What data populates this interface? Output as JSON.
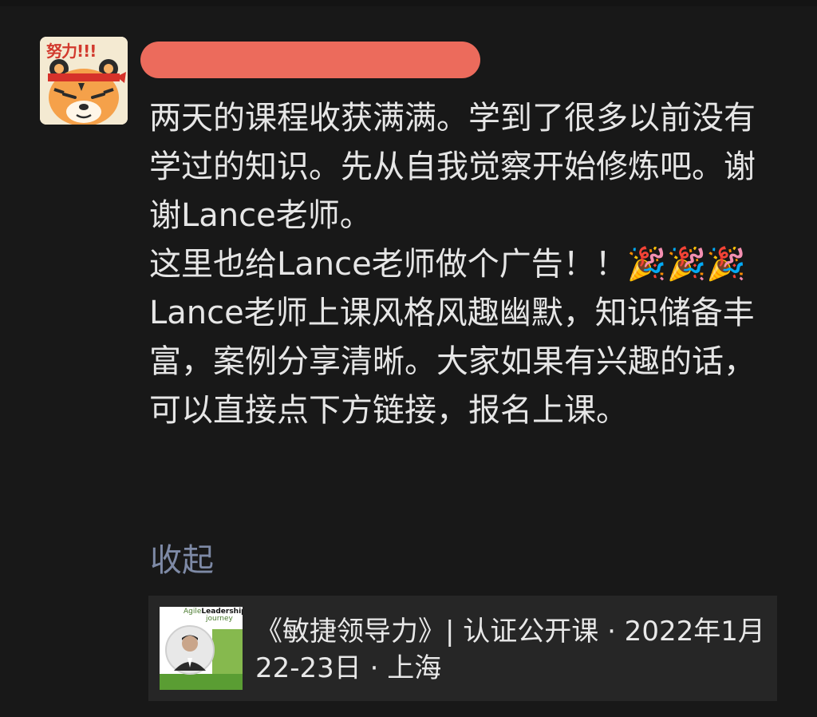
{
  "post": {
    "text": "两天的课程收获满满。学到了很多以前没有学过的知识。先从自我觉察开始修炼吧。谢谢Lance老师。\n这里也给Lance老师做个广告！！🎉🎉🎉\nLance老师上课风格风趣幽默，知识储备丰富，案例分享清晰。大家如果有兴趣的话，可以直接点下方链接，报名上课。",
    "collapse_label": "收起"
  },
  "avatar": {
    "caption": "努力!!!",
    "icon": "tiger-avatar-icon"
  },
  "link_card": {
    "title": "《敏捷领导力》| 认证公开课 · 2022年1月22-23日 · 上海",
    "thumbnail": {
      "brand_prefix": "Agile",
      "brand_main": "Leadership",
      "brand_suffix": "journey"
    }
  },
  "colors": {
    "background": "#181818",
    "text": "#e6e6e6",
    "link": "#7e8aa6",
    "card": "#262626",
    "redaction": "#ec6b5c"
  }
}
